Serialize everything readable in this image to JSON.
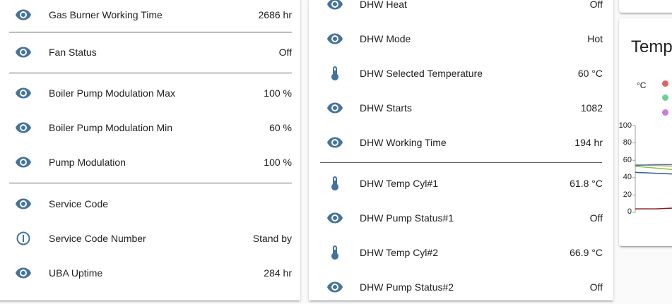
{
  "left_panel": {
    "rows": [
      {
        "icon": "eye-icon",
        "label": "Gas Burner Working Time",
        "value": "2686 hr"
      },
      {
        "icon": "eye-icon",
        "label": "Fan Status",
        "value": "Off"
      },
      {
        "icon": "eye-icon",
        "label": "Boiler Pump Modulation Max",
        "value": "100 %"
      },
      {
        "icon": "eye-icon",
        "label": "Boiler Pump Modulation Min",
        "value": "60 %"
      },
      {
        "icon": "eye-icon",
        "label": "Pump Modulation",
        "value": "100 %"
      },
      {
        "icon": "eye-icon",
        "label": "Service Code",
        "value": ""
      },
      {
        "icon": "info-circle-icon",
        "label": "Service Code Number",
        "value": "Stand by"
      },
      {
        "icon": "eye-icon",
        "label": "UBA Uptime",
        "value": "284 hr"
      }
    ]
  },
  "middle_panel": {
    "rows": [
      {
        "icon": "eye-icon",
        "label": "DHW Heat",
        "value": "Off"
      },
      {
        "icon": "eye-icon",
        "label": "DHW Mode",
        "value": "Hot"
      },
      {
        "icon": "thermometer-icon",
        "label": "DHW Selected Temperature",
        "value": "60 °C"
      },
      {
        "icon": "eye-icon",
        "label": "DHW Starts",
        "value": "1082"
      },
      {
        "icon": "eye-icon",
        "label": "DHW Working Time",
        "value": "194 hr"
      },
      {
        "icon": "thermometer-icon",
        "label": "DHW Temp Cyl#1",
        "value": "61.8 °C"
      },
      {
        "icon": "eye-icon",
        "label": "DHW Pump Status#1",
        "value": "Off"
      },
      {
        "icon": "thermometer-icon",
        "label": "DHW Temp Cyl#2",
        "value": "66.9 °C"
      },
      {
        "icon": "eye-icon",
        "label": "DHW Pump Status#2",
        "value": "Off"
      }
    ]
  },
  "chart_card": {
    "title": "Temp",
    "unit": "°C",
    "legend_colors": [
      "#e06666",
      "#6fcf97",
      "#c77ddb"
    ]
  },
  "chart_data": {
    "type": "line",
    "title": "Temp",
    "ylabel": "°C",
    "ylim": [
      0,
      100
    ],
    "y_ticks": [
      "100",
      "80",
      "60",
      "40",
      "20",
      "0"
    ],
    "series": [
      {
        "color": "#e6a23c",
        "values": [
          55,
          54,
          53
        ]
      },
      {
        "color": "#8bc34a",
        "values": [
          53,
          51,
          49
        ]
      },
      {
        "color": "#2f5d8a",
        "values": [
          46,
          45,
          44
        ]
      },
      {
        "color": "#3a7bd5",
        "values": [
          54,
          55,
          55
        ]
      },
      {
        "color": "#8b1a1a",
        "values": [
          4,
          4,
          5
        ]
      }
    ]
  },
  "colors": {
    "icon": "#44739e",
    "divider": "#616161",
    "card_bg": "#ffffff",
    "page_bg": "#fafafa"
  }
}
